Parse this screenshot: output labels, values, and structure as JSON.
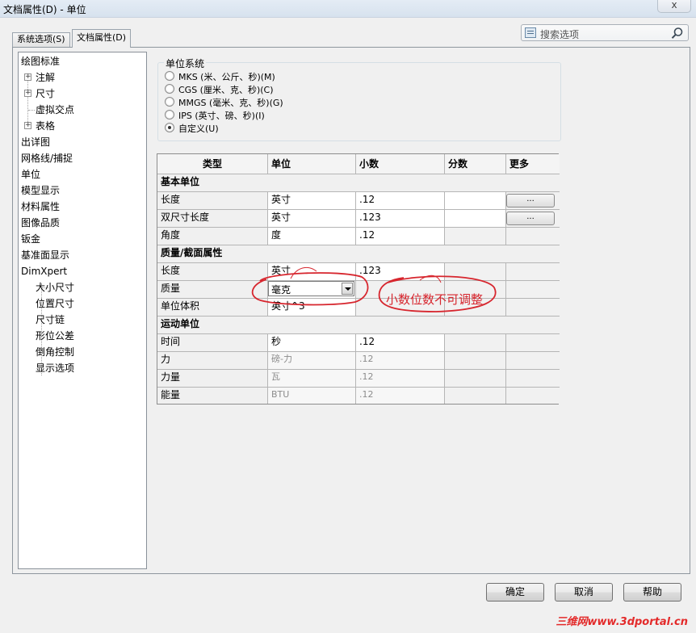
{
  "window": {
    "title": "文档属性(D) - 单位",
    "close_glyph": "x"
  },
  "tabs": [
    {
      "label": "系统选项(S)",
      "active": false
    },
    {
      "label": "文档属性(D)",
      "active": true
    }
  ],
  "search": {
    "placeholder": "搜索选项"
  },
  "tree": {
    "items": [
      {
        "label": "绘图标准"
      },
      {
        "label": "注解",
        "expander": "+"
      },
      {
        "label": "尺寸",
        "expander": "+"
      },
      {
        "label": "虚拟交点"
      },
      {
        "label": "表格",
        "expander": "+"
      },
      {
        "label": "出详图"
      },
      {
        "label": "网格线/捕捉"
      },
      {
        "label": "单位"
      },
      {
        "label": "模型显示"
      },
      {
        "label": "材料属性"
      },
      {
        "label": "图像品质"
      },
      {
        "label": "钣金"
      },
      {
        "label": "基准面显示"
      },
      {
        "label": "DimXpert"
      },
      {
        "label": "大小尺寸"
      },
      {
        "label": "位置尺寸"
      },
      {
        "label": "尺寸链"
      },
      {
        "label": "形位公差"
      },
      {
        "label": "倒角控制"
      },
      {
        "label": "显示选项"
      }
    ]
  },
  "unit_system": {
    "title": "单位系统",
    "options": [
      {
        "label": "MKS (米、公斤、秒)(M)",
        "checked": false
      },
      {
        "label": "CGS (厘米、克、秒)(C)",
        "checked": false
      },
      {
        "label": "MMGS (毫米、克、秒)(G)",
        "checked": false
      },
      {
        "label": "IPS (英寸、磅、秒)(I)",
        "checked": false
      },
      {
        "label": "自定义(U)",
        "checked": true
      }
    ]
  },
  "grid": {
    "headers": [
      "类型",
      "单位",
      "小数",
      "分数",
      "更多"
    ],
    "sections": {
      "basic": "基本单位",
      "mass": "质量/截面属性",
      "motion": "运动单位"
    },
    "rows": {
      "length": {
        "type": "长度",
        "unit": "英寸",
        "decimal": ".12",
        "more": "..."
      },
      "dual_length": {
        "type": "双尺寸长度",
        "unit": "英寸",
        "decimal": ".123",
        "more": "..."
      },
      "angle": {
        "type": "角度",
        "unit": "度",
        "decimal": ".12"
      },
      "mass_length": {
        "type": "长度",
        "unit": "英寸",
        "decimal": ".123"
      },
      "mass": {
        "type": "质量",
        "unit": "毫克"
      },
      "volume": {
        "type": "单位体积",
        "unit": "英寸^3"
      },
      "time": {
        "type": "时间",
        "unit": "秒",
        "decimal": ".12"
      },
      "force": {
        "type": "力",
        "unit": "磅-力",
        "decimal": ".12"
      },
      "power": {
        "type": "力量",
        "unit": "瓦",
        "decimal": ".12"
      },
      "energy": {
        "type": "能量",
        "unit": "BTU",
        "decimal": ".12"
      }
    }
  },
  "annotation": {
    "text": "小数位数不可调整",
    "color": "#d7262e"
  },
  "buttons": {
    "ok": "确定",
    "cancel": "取消",
    "help": "帮助"
  },
  "watermark": "三维网www.3dportal.cn"
}
